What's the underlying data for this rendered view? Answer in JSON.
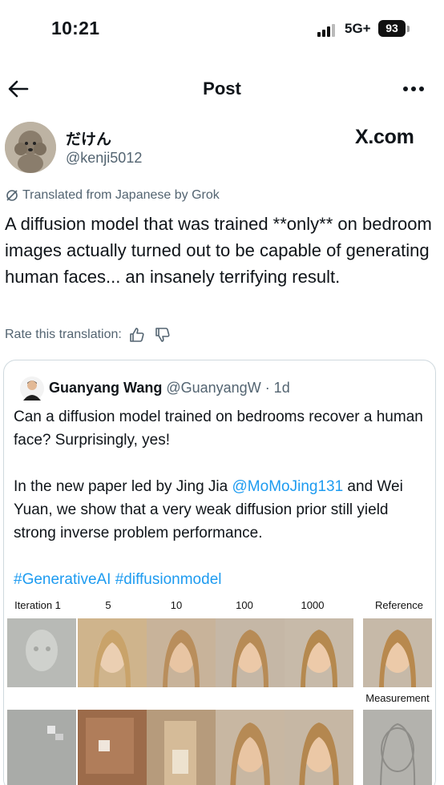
{
  "status_bar": {
    "time": "10:21",
    "network": "5G+",
    "battery": "93"
  },
  "header": {
    "title": "Post"
  },
  "author": {
    "name": "だけん",
    "handle": "@kenji5012"
  },
  "brand": "X.com",
  "translation_note": "Translated from Japanese by Grok",
  "tweet_text": "A diffusion model that was trained **only** on bedroom images actually turned out to be capable of generating human faces... an insanely terrifying result.",
  "rate_translation": "Rate this translation:",
  "quote": {
    "name": "Guanyang Wang",
    "handle": "@GuanyangW",
    "time": " · 1d",
    "p1": "Can a diffusion model trained on bedrooms recover a human face? Surprisingly, yes!",
    "p2_pre": "In the new paper led by Jing Jia ",
    "p2_mention": "@MoMoJing131",
    "p2_post": " and Wei Yuan, we show that a very weak diffusion prior still yield strong inverse problem performance.",
    "hashtags": "#GenerativeAI #diffusionmodel"
  },
  "figure": {
    "labels": [
      "Iteration 1",
      "5",
      "10",
      "100",
      "1000",
      "Reference"
    ],
    "measurement_label": "Measurement"
  },
  "colors": {
    "link": "#1d9bf0",
    "secondary": "#536471",
    "border": "#cfd9de"
  }
}
